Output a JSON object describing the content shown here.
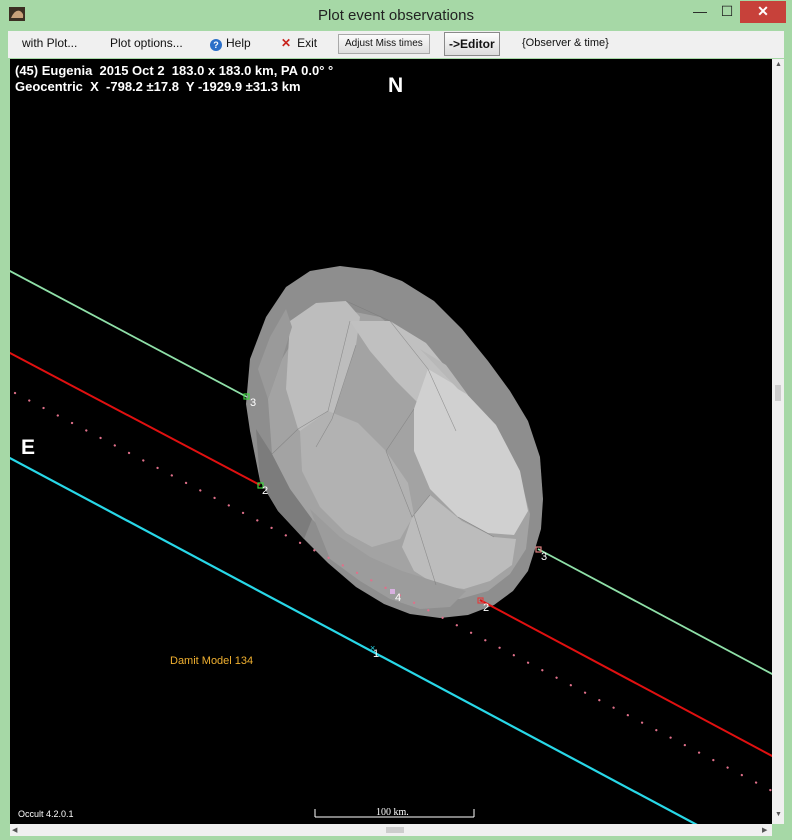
{
  "window": {
    "title": "Plot event observations",
    "min_glyph": "—",
    "max_glyph": "☐",
    "close_glyph": "✕"
  },
  "toolbar": {
    "with_plot": "with Plot...",
    "plot_options": "Plot options...",
    "help_label": "Help",
    "help_glyph": "?",
    "exit_label": "Exit",
    "exit_glyph": "✕",
    "adjust_miss": "Adjust Miss times",
    "editor": "->Editor",
    "observer_time": "{Observer & time}"
  },
  "plot": {
    "header_line1": "(45) Eugenia  2015 Oct 2  183.0 x 183.0 km, PA 0.0° °",
    "header_line2": "Geocentric  X  -798.2 ±17.8  Y -1929.9 ±31.3 km",
    "north_label": "N",
    "east_label": "E",
    "model_label": "Damit Model 134",
    "scale_label": "100 km.",
    "version_label": "Occult 4.2.0.1",
    "colors": {
      "background": "#000000",
      "chord_green": "#8fe0a8",
      "chord_red": "#e01010",
      "chord_cyan": "#28d8e8",
      "miss_dots": "#e0708a",
      "model_fill": "#c8c8c8"
    },
    "chords": [
      {
        "id": "3",
        "kind": "positive",
        "color": "green",
        "labels": [
          "3",
          "3"
        ]
      },
      {
        "id": "2",
        "kind": "positive",
        "color": "red",
        "labels": [
          "2",
          "2"
        ]
      },
      {
        "id": "1",
        "kind": "miss",
        "color": "cyan",
        "labels": [
          "1"
        ]
      },
      {
        "id": "4",
        "kind": "miss-dotted",
        "color": "pink",
        "labels": [
          "4"
        ]
      }
    ]
  }
}
